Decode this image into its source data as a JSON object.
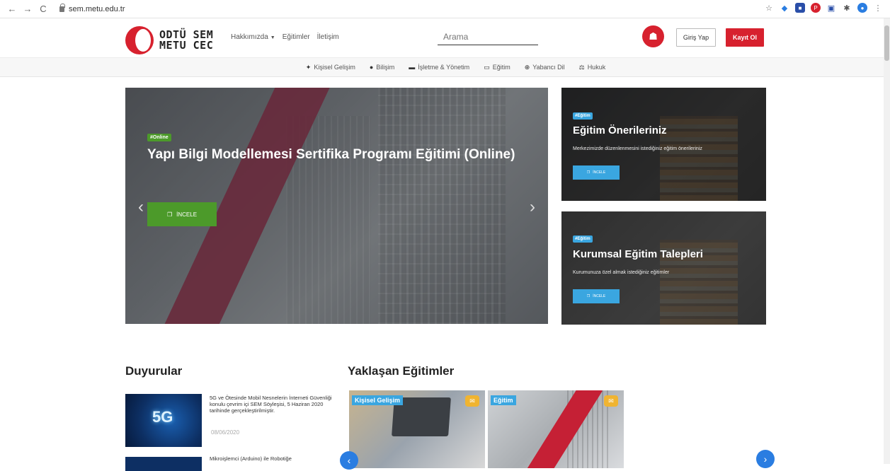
{
  "browser": {
    "url": "sem.metu.edu.tr"
  },
  "header": {
    "logo_line1": "ODTÜ SEM",
    "logo_line2": "METU CEC",
    "menu": [
      {
        "label": "Hakkımızda"
      },
      {
        "label": "Eğitimler"
      },
      {
        "label": "İletişim"
      }
    ],
    "search_placeholder": "Arama",
    "login_label": "Giriş Yap",
    "register_label": "Kayıt Ol"
  },
  "categories": [
    {
      "label": "Kişisel Gelişim",
      "icon": "person-icon"
    },
    {
      "label": "Bilişim",
      "icon": "brain-icon"
    },
    {
      "label": "İşletme & Yönetim",
      "icon": "briefcase-icon"
    },
    {
      "label": "Eğitim",
      "icon": "board-icon"
    },
    {
      "label": "Yabancı Dil",
      "icon": "globe-icon"
    },
    {
      "label": "Hukuk",
      "icon": "scale-icon"
    }
  ],
  "hero": {
    "tag": "#Online",
    "title": "Yapı Bilgi Modellemesi Sertifika Programı Eğitimi (Online)",
    "button": "İNCELE"
  },
  "cards": [
    {
      "tag": "#Eğitim",
      "title": "Eğitim Önerileriniz",
      "subtitle": "Merkezimizde düzenlenmesini istediğiniz eğitim önerileriniz",
      "button": "İNCELE"
    },
    {
      "tag": "#Eğitim",
      "title": "Kurumsal Eğitim Talepleri",
      "subtitle": "Kurumunuza özel almak istediğiniz eğitimler",
      "button": "İNCELE"
    }
  ],
  "announcements": {
    "heading": "Duyurular",
    "items": [
      {
        "image_text": "5G",
        "text": "5G ve Ötesinde Mobil Nesnelerin İnterneti Güvenliği konulu çevrim içi SEM Söyleşisi, 5 Haziran 2020 tarihinde gerçekleştirilmiştir.",
        "date": "08/06/2020"
      },
      {
        "text": "Mikroişlemci (Arduino) ile Robotiğe"
      }
    ]
  },
  "upcoming": {
    "heading": "Yaklaşan Eğitimler",
    "courses": [
      {
        "tag": "Kişisel Gelişim"
      },
      {
        "tag": "Eğitim"
      }
    ]
  },
  "icons": {
    "back": "←",
    "forward": "→",
    "reload": "C",
    "star": "☆",
    "caret": "▼",
    "prev": "‹",
    "next": "›",
    "megaphone": "✉"
  },
  "colors": {
    "brand_red": "#d7212e",
    "green": "#4c9a2a",
    "blue": "#3aa6e0"
  }
}
